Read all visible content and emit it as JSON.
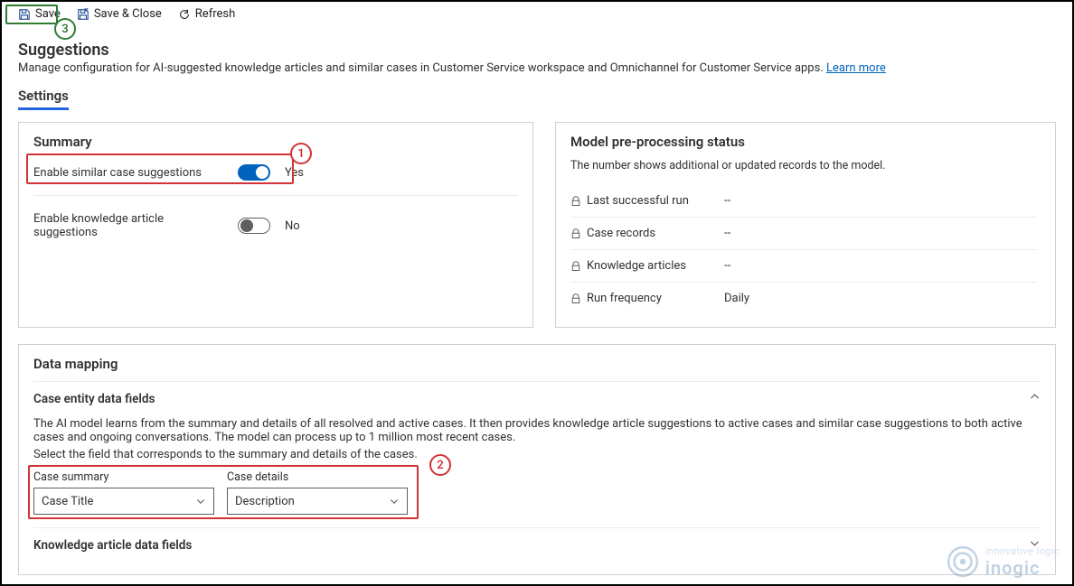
{
  "toolbar": {
    "save": "Save",
    "saveClose": "Save & Close",
    "refresh": "Refresh"
  },
  "page": {
    "title": "Suggestions",
    "subtitle": "Manage configuration for AI-suggested knowledge articles and similar cases in Customer Service workspace and Omnichannel for Customer Service apps.",
    "learnMore": "Learn more"
  },
  "tabs": {
    "settings": "Settings"
  },
  "summary": {
    "heading": "Summary",
    "similarLabel": "Enable similar case suggestions",
    "similarState": "Yes",
    "knowledgeLabel": "Enable knowledge article suggestions",
    "knowledgeState": "No"
  },
  "status": {
    "heading": "Model pre-processing status",
    "sub": "The number shows additional or updated records to the model.",
    "rows": [
      {
        "label": "Last successful run",
        "value": "--"
      },
      {
        "label": "Case records",
        "value": "--"
      },
      {
        "label": "Knowledge articles",
        "value": "--"
      },
      {
        "label": "Run frequency",
        "value": "Daily"
      }
    ]
  },
  "mapping": {
    "heading": "Data mapping",
    "caseSection": "Case entity data fields",
    "caseDesc1": "The AI model learns from the summary and details of all resolved and active cases. It then provides knowledge article suggestions to active cases and similar case suggestions to both active cases and ongoing conversations. The model can process up to 1 million most recent cases.",
    "caseDesc2": "Select the field that corresponds to the summary and details of the cases.",
    "summaryFieldLabel": "Case summary",
    "summaryFieldValue": "Case Title",
    "detailsFieldLabel": "Case details",
    "detailsFieldValue": "Description",
    "kaSection": "Knowledge article data fields"
  },
  "annotations": {
    "n1": "1",
    "n2": "2",
    "n3": "3"
  },
  "brand": {
    "line1": "innovative logic",
    "line2": "inogic"
  }
}
